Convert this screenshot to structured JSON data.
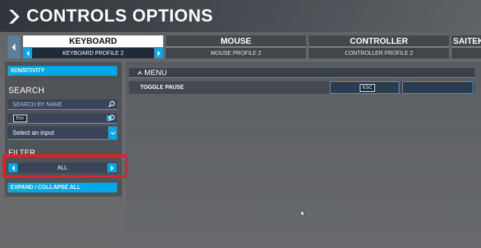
{
  "header": {
    "title": "CONTROLS OPTIONS"
  },
  "tabs": [
    {
      "label": "KEYBOARD",
      "profile": "KEYBOARD PROFILE 2"
    },
    {
      "label": "MOUSE",
      "profile": "MOUSE PROFILE 2"
    },
    {
      "label": "CONTROLLER",
      "profile": "CONTROLLER PROFILE 2"
    },
    {
      "label": "SAITEK"
    }
  ],
  "sidebar": {
    "sensitivity_label": "SENSITIVITY",
    "search_heading": "SEARCH",
    "search_by_name_placeholder": "SEARCH BY NAME",
    "search_by_input_value": "Esc",
    "clear_label": "x",
    "input_select_value": "Select an input",
    "filter_heading": "FILTER",
    "filter_value": "ALL",
    "expand_collapse_label": "EXPAND / COLLAPSE ALL"
  },
  "bindings": {
    "category": "MENU",
    "rows": [
      {
        "action": "TOGGLE PAUSE",
        "primary": "ESC",
        "secondary": ""
      }
    ]
  },
  "colors": {
    "accent": "#00a8e8",
    "highlight": "#e3202a"
  },
  "icons": [
    "back-chevron-icon",
    "chevron-left-icon",
    "chevron-right-icon",
    "search-icon",
    "dropdown-arrow-icon",
    "cursor-icon"
  ]
}
